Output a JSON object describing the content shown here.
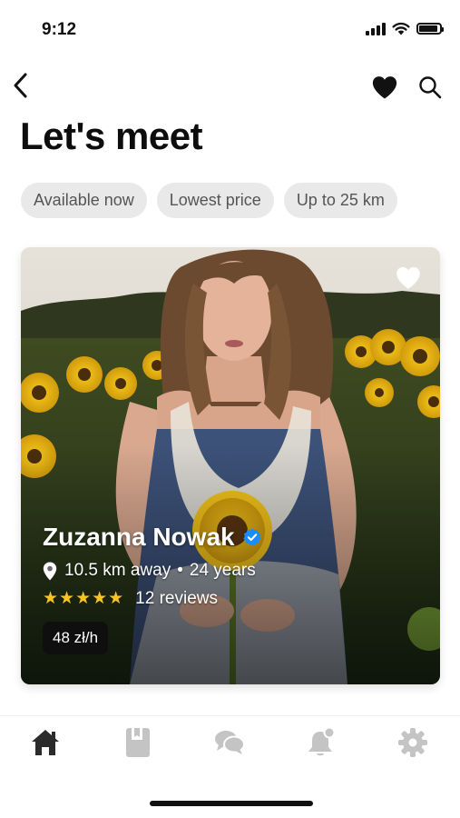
{
  "status_bar": {
    "time": "9:12"
  },
  "header": {
    "title": "Let's meet"
  },
  "icons": {
    "back": "chevron-left-icon",
    "favorites": "heart-icon",
    "search": "search-icon"
  },
  "filters": [
    {
      "label": "Available now"
    },
    {
      "label": "Lowest price"
    },
    {
      "label": "Up to 25 km"
    }
  ],
  "profile_card": {
    "name": "Zuzanna Nowak",
    "verified": true,
    "distance": "10.5 km away",
    "age": "24 years",
    "rating_stars": 5,
    "stars_text": "★★★★★",
    "reviews": "12 reviews",
    "price": "48 zł/h"
  },
  "tab_bar": {
    "items": [
      {
        "icon": "home-icon",
        "active": true
      },
      {
        "icon": "book-icon",
        "active": false
      },
      {
        "icon": "chat-icon",
        "active": false
      },
      {
        "icon": "notification-bell-icon",
        "active": false
      },
      {
        "icon": "gear-icon",
        "active": false
      }
    ]
  },
  "colors": {
    "accent_verified": "#1a8cff",
    "star": "#f6c523",
    "active_tab": "#2b2b2b",
    "inactive_tab": "#c4c4c4"
  }
}
